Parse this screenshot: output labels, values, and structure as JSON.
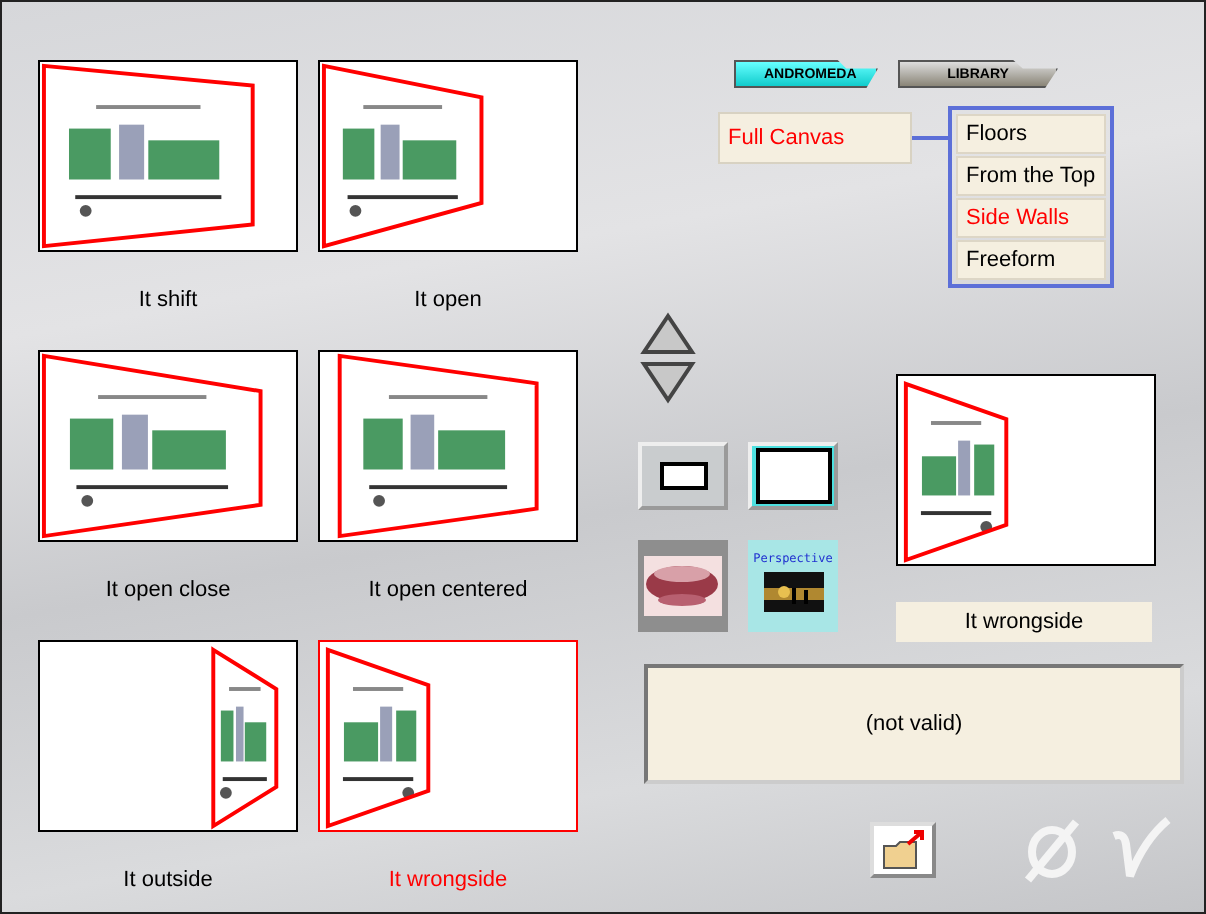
{
  "thumbnails": [
    {
      "label": "It shift",
      "kind": "shift",
      "selected": false
    },
    {
      "label": "It open",
      "kind": "open",
      "selected": false
    },
    {
      "label": "It open close",
      "kind": "open_close",
      "selected": false
    },
    {
      "label": "It open centered",
      "kind": "open_centered",
      "selected": false
    },
    {
      "label": "It outside",
      "kind": "outside",
      "selected": false
    },
    {
      "label": "It wrongside",
      "kind": "wrongside",
      "selected": true
    }
  ],
  "tabs": [
    {
      "label": "ANDROMEDA",
      "selected": true
    },
    {
      "label": "LIBRARY",
      "selected": false
    }
  ],
  "mode": {
    "label": "Full Canvas",
    "selected": true
  },
  "options": [
    {
      "label": "Floors",
      "selected": false
    },
    {
      "label": "From the Top",
      "selected": false
    },
    {
      "label": "Side Walls",
      "selected": true
    },
    {
      "label": "Freeform",
      "selected": false
    }
  ],
  "tiles": {
    "perspective": "Perspective"
  },
  "preview": {
    "kind": "wrongside",
    "label": "It wrongside"
  },
  "status": "(not valid)"
}
